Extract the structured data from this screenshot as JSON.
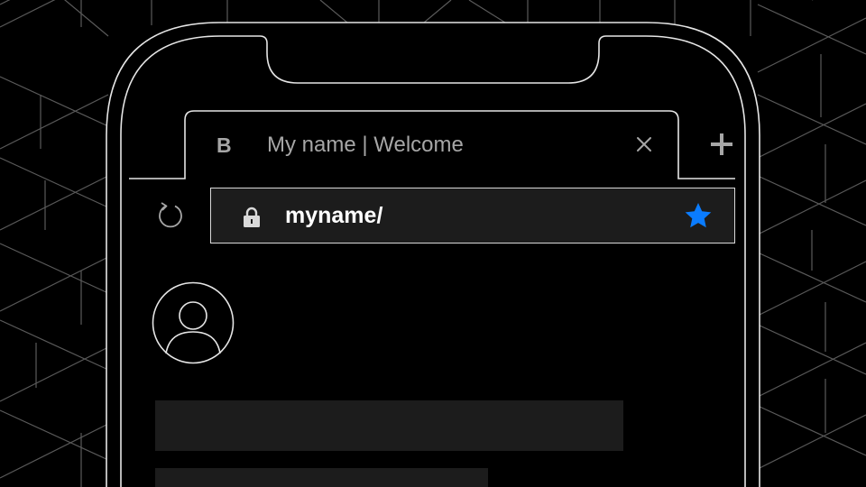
{
  "browser": {
    "tab": {
      "favicon_letter": "B",
      "title": "My name | Welcome"
    },
    "address_bar": {
      "url": "myname/"
    }
  },
  "icons": {
    "tab_close": "close-icon",
    "new_tab": "plus-icon",
    "reload": "reload-icon",
    "lock": "lock-icon",
    "bookmark": "star-icon",
    "avatar": "user-avatar-icon"
  },
  "colors": {
    "background": "#000000",
    "line": "#e6e6e6",
    "text_muted": "#a6a6a6",
    "field_fill": "#1c1c1c",
    "accent_star": "#0a7cff"
  }
}
